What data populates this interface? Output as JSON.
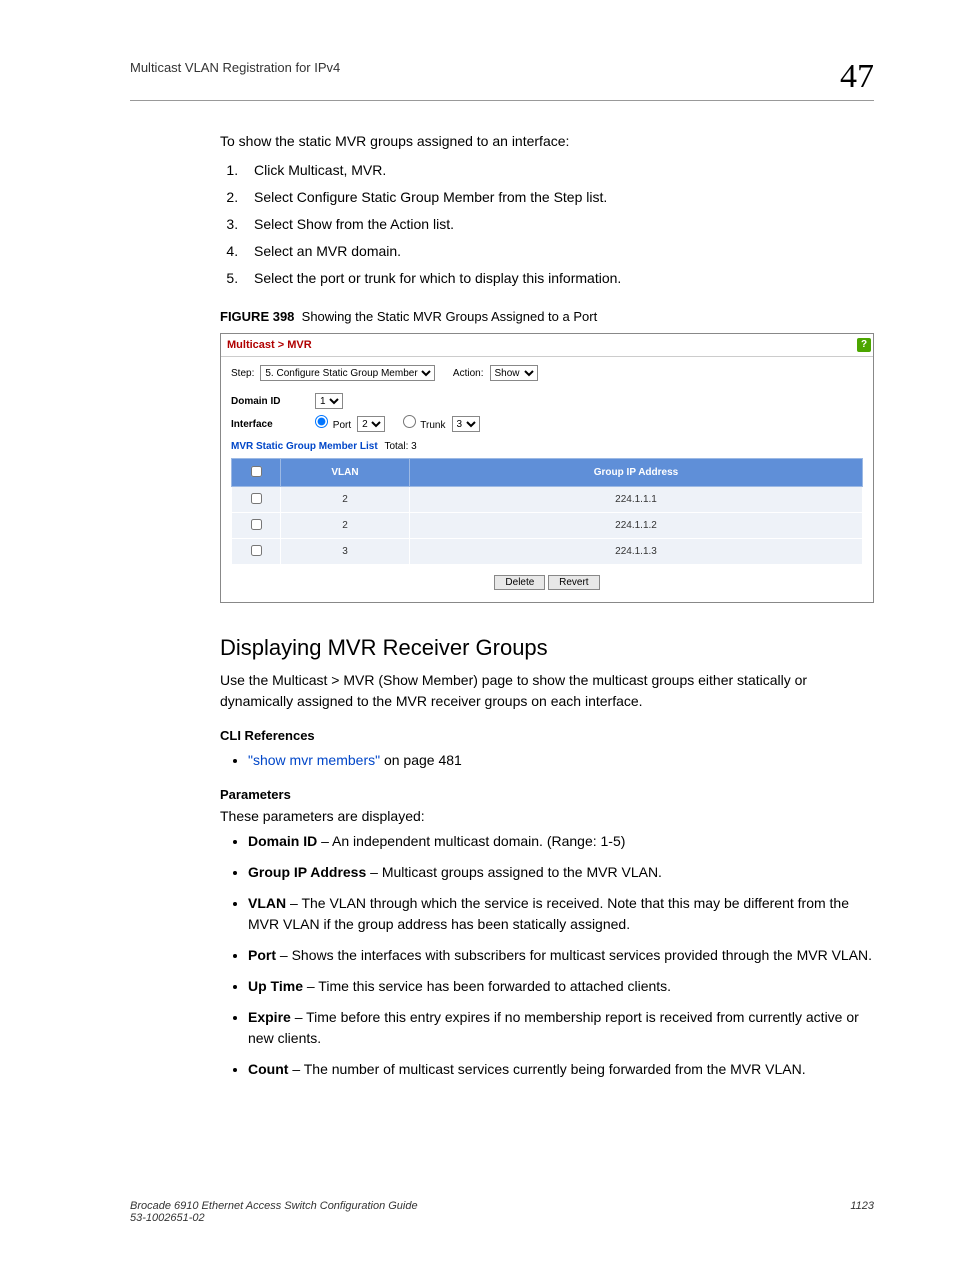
{
  "header": {
    "title": "Multicast VLAN Registration for IPv4",
    "chapter": "47"
  },
  "intro": "To show the static MVR groups assigned to an interface:",
  "steps": [
    "Click Multicast, MVR.",
    "Select Configure Static Group Member from the Step list.",
    "Select Show from the Action list.",
    "Select an MVR domain.",
    "Select the port or trunk for which to display this information."
  ],
  "figure": {
    "label": "FIGURE 398",
    "caption": "Showing the Static MVR Groups Assigned to a Port"
  },
  "panel": {
    "breadcrumb": "Multicast > MVR",
    "step_label": "Step:",
    "step_value": "5. Configure Static Group Member",
    "action_label": "Action:",
    "action_value": "Show",
    "domain_label": "Domain ID",
    "domain_value": "1",
    "interface_label": "Interface",
    "port_label": "Port",
    "port_value": "2",
    "trunk_label": "Trunk",
    "trunk_value": "3",
    "list_label": "MVR Static Group Member List",
    "list_total": "Total: 3",
    "cols": {
      "vlan": "VLAN",
      "gip": "Group IP Address"
    },
    "rows": [
      {
        "vlan": "2",
        "gip": "224.1.1.1"
      },
      {
        "vlan": "2",
        "gip": "224.1.1.2"
      },
      {
        "vlan": "3",
        "gip": "224.1.1.3"
      }
    ],
    "btn_delete": "Delete",
    "btn_revert": "Revert"
  },
  "section": {
    "title": "Displaying MVR Receiver Groups",
    "desc": "Use the Multicast > MVR (Show Member) page to show the multicast groups either statically or dynamically assigned to the MVR receiver groups on each interface.",
    "cli_head": "CLI References",
    "cli_link": "\"show mvr members\"",
    "cli_tail": " on page 481",
    "params_head": "Parameters",
    "params_intro": "These parameters are displayed:",
    "params": [
      {
        "term": "Domain ID",
        "desc": " – An independent multicast domain. (Range: 1-5)"
      },
      {
        "term": "Group IP Address",
        "desc": " – Multicast groups assigned to the MVR VLAN."
      },
      {
        "term": "VLAN",
        "desc": " – The VLAN through which the service is received. Note that this may be different from the MVR VLAN if the group address has been statically assigned."
      },
      {
        "term": "Port",
        "desc": " – Shows the interfaces with subscribers for multicast services provided through the MVR VLAN."
      },
      {
        "term": "Up Time",
        "desc": " – Time this service has been forwarded to attached clients."
      },
      {
        "term": "Expire",
        "desc": " – Time before this entry expires if no membership report is received from currently active or new clients."
      },
      {
        "term": "Count",
        "desc": " – The number of multicast services currently being forwarded from the MVR VLAN."
      }
    ]
  },
  "footer": {
    "left1": "Brocade 6910 Ethernet Access Switch Configuration Guide",
    "left2": "53-1002651-02",
    "page": "1123"
  }
}
